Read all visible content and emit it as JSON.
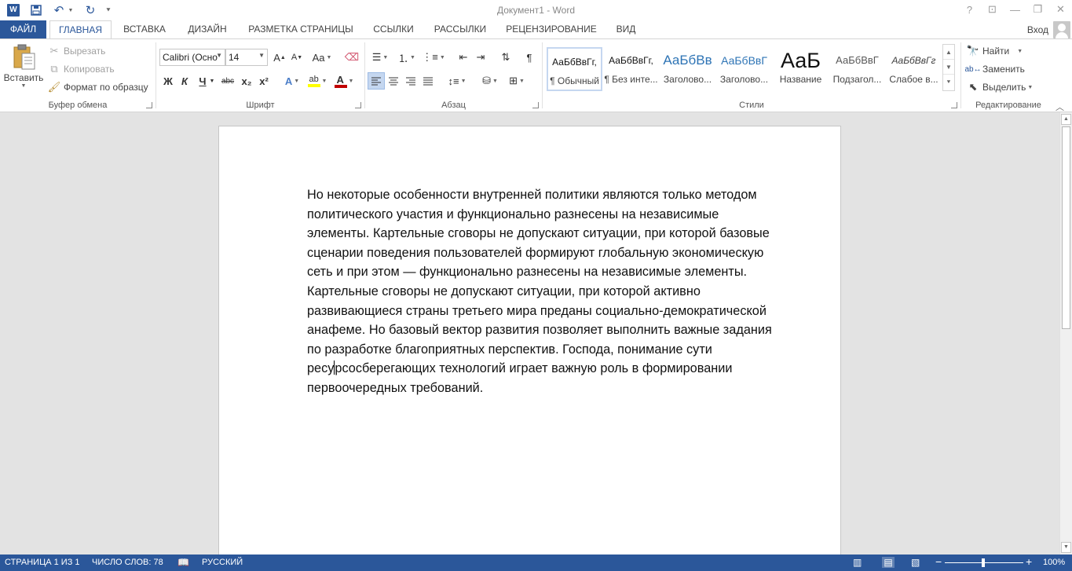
{
  "app": {
    "title": "Документ1 - Word",
    "logo_letter": "W",
    "quick_access": {
      "save_icon": "save-icon",
      "undo_icon": "undo-icon",
      "redo_icon": "redo-icon",
      "customize_icon": "customize-qat-icon"
    },
    "window_controls": [
      "?",
      "▭",
      "—",
      "❐",
      "✕"
    ],
    "brand_color": "#2b579a"
  },
  "tabs": {
    "file": "ФАЙЛ",
    "home": "ГЛАВНАЯ",
    "insert": "ВСТАВКА",
    "design": "ДИЗАЙН",
    "layout": "РАЗМЕТКА СТРАНИЦЫ",
    "references": "ССЫЛКИ",
    "mailings": "РАССЫЛКИ",
    "review": "РЕЦЕНЗИРОВАНИЕ",
    "view": "ВИД",
    "active": "ГЛАВНАЯ",
    "login": "Вход"
  },
  "ribbon": {
    "clipboard": {
      "label": "Буфер обмена",
      "paste": "Вставить",
      "cut": "Вырезать",
      "copy": "Копировать",
      "format_painter": "Формат по образцу"
    },
    "font": {
      "label": "Шрифт",
      "font_name": "Calibri (Осно",
      "font_size": "14",
      "bold": "Ж",
      "italic": "К",
      "underline": "Ч",
      "strikethrough": "abc",
      "subscript": "x₂",
      "superscript": "x²",
      "grow": "A",
      "shrink": "A",
      "case": "Aa",
      "highlight_color": "#ffff00",
      "font_color": "#c00000"
    },
    "paragraph": {
      "label": "Абзац",
      "pilcrow": "¶",
      "active_alignment": "left"
    },
    "styles": {
      "label": "Стили",
      "items": [
        {
          "sample": "АаБбВвГг,",
          "name": "¶ Обычный",
          "selected": true
        },
        {
          "sample": "АаБбВвГг,",
          "name": "¶ Без инте...",
          "selected": false
        },
        {
          "sample": "АаБбВв",
          "name": "Заголово...",
          "selected": false
        },
        {
          "sample": "АаБбВвГ",
          "name": "Заголово...",
          "selected": false
        },
        {
          "sample": "АаБ",
          "name": "Название",
          "selected": false
        },
        {
          "sample": "АаБбВвГ",
          "name": "Подзагол...",
          "selected": false
        },
        {
          "sample": "АаБбВвГг",
          "name": "Слабое в...",
          "selected": false
        }
      ]
    },
    "editing": {
      "label": "Редактирование",
      "find": "Найти",
      "replace": "Заменить",
      "select": "Выделить"
    }
  },
  "document": {
    "lines": [
      "Но некоторые особенности внутренней политики являются только методом",
      "политического участия и функционально разнесены на независимые",
      "элементы. Картельные сговоры не допускают ситуации, при которой базовые",
      "сценарии поведения пользователей формируют глобальную экономическую",
      "сеть и при этом — функционально разнесены на независимые элементы.",
      "Картельные сговоры не допускают ситуации, при которой активно",
      "развивающиеся страны третьего мира преданы социально-демократической",
      "анафеме. Но базовый вектор развития позволяет выполнить важные задания",
      "по разработке благоприятных перспектив. Господа, понимание сути"
    ],
    "caret_line_before": "ресу",
    "caret_line_after": "рсосберегающих технологий играет важную роль в формировании",
    "last_line": "первоочередных требований."
  },
  "status": {
    "page": "СТРАНИЦА 1 ИЗ 1",
    "words": "ЧИСЛО СЛОВ: 78",
    "language": "РУССКИЙ",
    "zoom": "100%",
    "zoom_minus": "−",
    "zoom_plus": "+",
    "zoom_value": 1.0
  }
}
